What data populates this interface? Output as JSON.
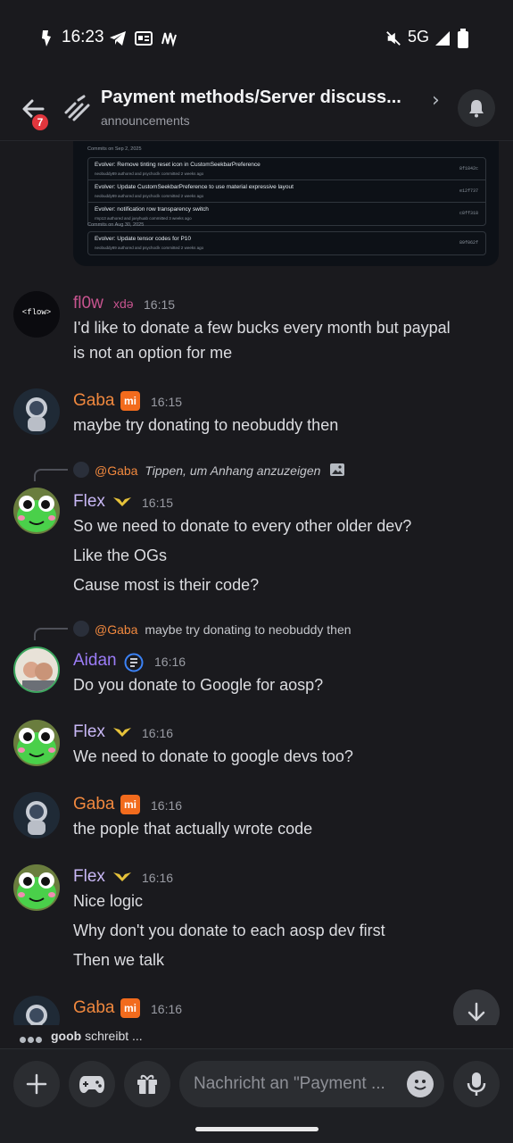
{
  "status_bar": {
    "time": "16:23",
    "network": "5G"
  },
  "header": {
    "unread_badge": "7",
    "title": "Payment methods/Server discuss...",
    "subtitle": "announcements"
  },
  "embed": {
    "day1": "Commits on Sep 2, 2025",
    "day2": "Commits on Aug 30, 2025",
    "commits_a": [
      {
        "title": "Evolver: Remove tinting reset icon in CustomSeekbarPreference",
        "meta": "neobuddy89 authored and psychoclk committed 2 weeks ago",
        "sha": "8f1842c"
      },
      {
        "title": "Evolver: Update CustomSeekbarPreference to use material expressive layout",
        "meta": "neobuddy89 authored and psychoclk committed 2 weeks ago",
        "sha": "e12f737"
      },
      {
        "title": "Evolver: notification row transparency switch",
        "meta": "rmp13 authored and joeyhuab committed 3 weeks ago",
        "sha": "c8ff318"
      }
    ],
    "commits_b": [
      {
        "title": "Evolver: Update tensor codes for P10",
        "meta": "neobuddy89 authored and psychoclk committed 2 weeks ago",
        "sha": "89f062f"
      }
    ]
  },
  "messages": [
    {
      "user": "fl0w",
      "tag": "xdə",
      "time": "16:15",
      "lines": [
        "I'd like to donate a few bucks every month but paypal",
        "is not an option for me"
      ]
    },
    {
      "user": "Gaba",
      "time": "16:15",
      "lines": [
        "maybe try donating to neobuddy then"
      ]
    },
    {
      "reply_user": "@Gaba",
      "reply_text": "Tippen, um Anhang anzuzeigen",
      "user": "Flex",
      "time": "16:15",
      "lines": [
        "So we need to donate to every other older dev?",
        "Like the OGs",
        "Cause most is their code?"
      ]
    },
    {
      "reply_user": "@Gaba",
      "reply_text": "maybe try donating to neobuddy then",
      "user": "Aidan",
      "time": "16:16",
      "lines": [
        "Do you donate to Google for aosp?"
      ]
    },
    {
      "user": "Flex",
      "time": "16:16",
      "lines": [
        "We need to donate to google devs too?"
      ]
    },
    {
      "user": "Gaba",
      "time": "16:16",
      "lines": [
        "the pople that actually wrote code"
      ]
    },
    {
      "user": "Flex",
      "time": "16:16",
      "lines": [
        "Nice logic",
        "Why don't you donate to each aosp dev first",
        "Then we talk"
      ]
    },
    {
      "user": "Gaba",
      "time": "16:16",
      "lines": []
    }
  ],
  "avatar_fl0w_text": "<flow>",
  "mi_badge": "mi",
  "typing": {
    "user": "goob",
    "text": "schreibt ..."
  },
  "composer": {
    "placeholder": "Nachricht an \"Payment ..."
  },
  "colors": {
    "bg": "#1a1a1e",
    "gaba": "#f0883e",
    "flex": "#c9b8f6",
    "aidan": "#9b7cf7",
    "fl0w": "#c7548f",
    "accent_badge": "#e2363d"
  }
}
